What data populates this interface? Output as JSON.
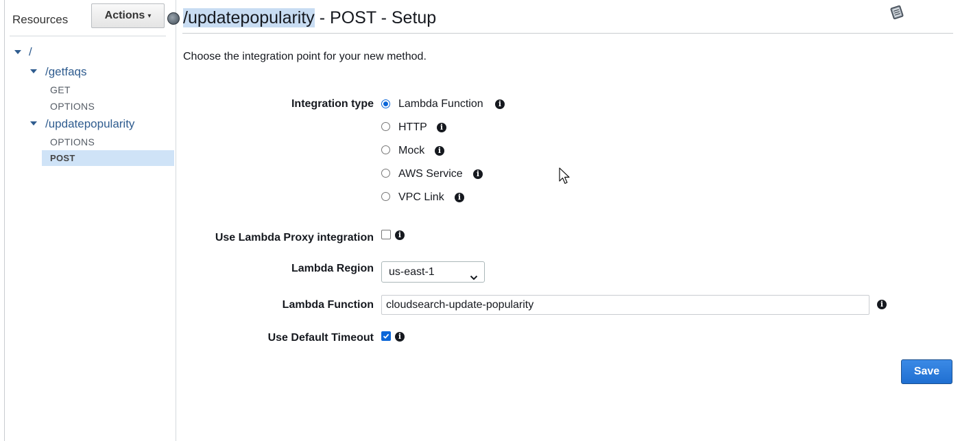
{
  "sidebar": {
    "title": "Resources",
    "actions_label": "Actions",
    "tree": {
      "root": "/",
      "getfaqs": {
        "label": "/getfaqs",
        "methods": [
          "GET",
          "OPTIONS"
        ]
      },
      "updatepopularity": {
        "label": "/updatepopularity",
        "methods": [
          "OPTIONS",
          "POST"
        ],
        "selected": "POST"
      }
    }
  },
  "header": {
    "resource_path": "/updatepopularity",
    "title_suffix": " - POST - Setup"
  },
  "intro_text": "Choose the integration point for your new method.",
  "form": {
    "integration_type": {
      "label": "Integration type",
      "options": [
        "Lambda Function",
        "HTTP",
        "Mock",
        "AWS Service",
        "VPC Link"
      ],
      "selected": "Lambda Function"
    },
    "proxy": {
      "label": "Use Lambda Proxy integration",
      "checked": false
    },
    "region": {
      "label": "Lambda Region",
      "value": "us-east-1"
    },
    "function": {
      "label": "Lambda Function",
      "value": "cloudsearch-update-popularity"
    },
    "timeout": {
      "label": "Use Default Timeout",
      "checked": true
    },
    "save_label": "Save"
  },
  "icons": {
    "info": "info-icon",
    "docs": "book-icon",
    "caret": "caret-down-icon"
  },
  "colors": {
    "accent": "#0a66d8",
    "link": "#2f5c8f",
    "selection": "#cfe3f7"
  }
}
